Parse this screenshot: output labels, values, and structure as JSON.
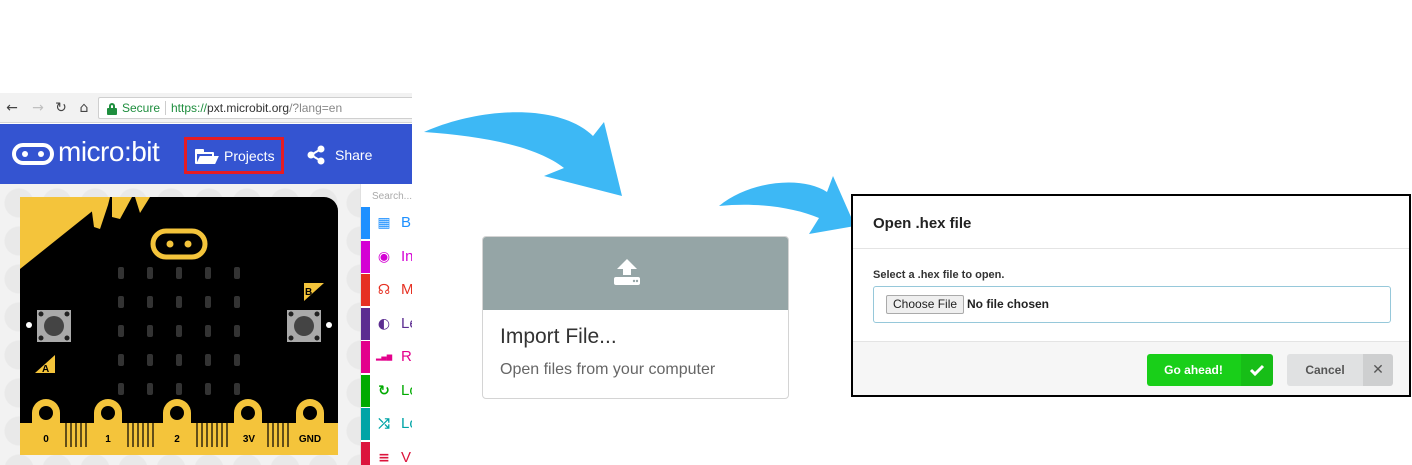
{
  "browser": {
    "back_icon": "←",
    "forward_icon": "→",
    "reload_icon": "↻",
    "home_icon": "⌂",
    "secure_label": "Secure",
    "url_protocol": "https://",
    "url_host": "pxt.microbit.org",
    "url_path": "/?lang=en"
  },
  "editor": {
    "logo_text": "micro:bit",
    "projects_label": "Projects",
    "share_label": "Share",
    "search_placeholder": "Search...",
    "categories": [
      {
        "icon": "grid-icon",
        "glyph": "▦",
        "label": "B",
        "color": "#1e90ff"
      },
      {
        "icon": "input-icon",
        "glyph": "◉",
        "label": "In",
        "color": "#d400d4"
      },
      {
        "icon": "headphones-icon",
        "glyph": "☊",
        "label": "M",
        "color": "#e63022"
      },
      {
        "icon": "toggle-icon",
        "glyph": "◐",
        "label": "Le",
        "color": "#5c2d91"
      },
      {
        "icon": "signal-icon",
        "glyph": "▂▄▆",
        "label": "R",
        "color": "#e3008c"
      },
      {
        "icon": "loop-icon",
        "glyph": "↻",
        "label": "Lo",
        "color": "#00aa00"
      },
      {
        "icon": "shuffle-icon",
        "glyph": "⤮",
        "label": "Lo",
        "color": "#00a4a6"
      },
      {
        "icon": "variables-icon",
        "glyph": "≡",
        "label": "V",
        "color": "#dc143c"
      }
    ],
    "board": {
      "button_a": "A",
      "button_b": "B",
      "pins": [
        "0",
        "1",
        "2",
        "3V",
        "GND"
      ]
    }
  },
  "import_card": {
    "icon": "upload-icon",
    "title": "Import File...",
    "description": "Open files from your computer"
  },
  "dialog": {
    "title": "Open .hex file",
    "label": "Select a .hex file to open.",
    "choose_button": "Choose File",
    "no_file_text": "No file chosen",
    "go_label": "Go ahead!",
    "cancel_label": "Cancel",
    "cancel_glyph": "✕"
  },
  "colors": {
    "header_blue": "#3454d1",
    "highlight_red": "#e51c23",
    "arrow_blue": "#3db8f5",
    "go_green": "#19cf19",
    "board_black": "#000000",
    "board_gold": "#f4c43b"
  }
}
